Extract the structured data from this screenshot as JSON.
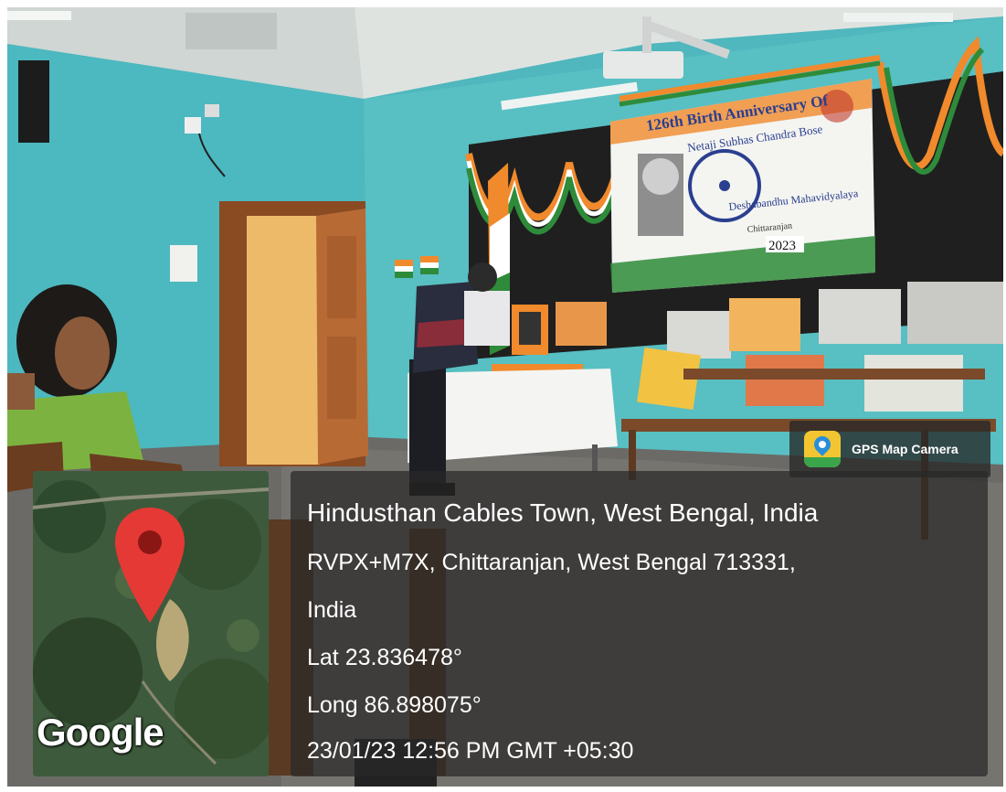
{
  "photo": {
    "banner_heading": "126th Birth Anniversary Of",
    "banner_subheading": "Netaji Subhas Chandra Bose",
    "banner_org": "Deshabandhu Mahavidyalaya",
    "banner_place": "Chittaranjan",
    "banner_year": "2023"
  },
  "stamp": {
    "badge_label": "GPS Map Camera",
    "title": "Hindusthan Cables Town, West Bengal, India",
    "address_line1": "RVPX+M7X, Chittaranjan, West Bengal 713331,",
    "address_line2": "India",
    "latitude": "Lat 23.836478°",
    "longitude": "Long 86.898075°",
    "datetime": "23/01/23 12:56 PM GMT +05:30"
  },
  "map": {
    "provider_logo": "Google",
    "pin_color": "#e53935"
  },
  "colors": {
    "wall": "#4fb7bd",
    "overlay": "#282828",
    "saffron": "#f08a2c",
    "green": "#2e8b3a"
  }
}
